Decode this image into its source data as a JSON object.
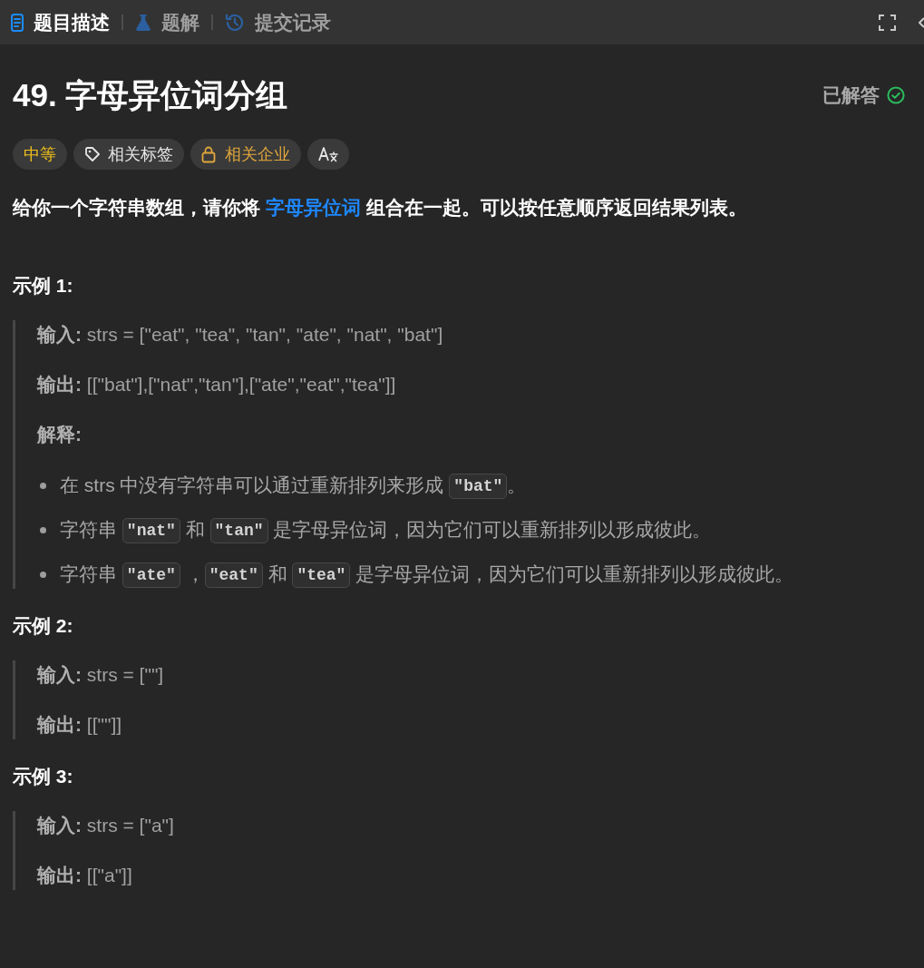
{
  "tabs": [
    {
      "label": "题目描述",
      "selected": true
    },
    {
      "label": "题解",
      "selected": false
    },
    {
      "label": "提交记录",
      "selected": false
    }
  ],
  "problem": {
    "title": "49. 字母异位词分组",
    "status": {
      "label": "已解答",
      "solved": true
    }
  },
  "tags": [
    {
      "kind": "difficulty",
      "label": "中等"
    },
    {
      "kind": "topics",
      "label": "相关标签"
    },
    {
      "kind": "companies",
      "label": "相关企业"
    },
    {
      "kind": "translate"
    }
  ],
  "description": [
    {
      "kind": "text",
      "text": "给你一个字符串数组，请你将 "
    },
    {
      "kind": "link",
      "text": "字母异位词"
    },
    {
      "kind": "text",
      "text": " 组合在一起。可以按任意顺序返回结果列表。"
    }
  ],
  "examples": [
    {
      "title": "示例 1:",
      "lines": [
        "**输入:** strs = [\"eat\", \"tea\", \"tan\", \"ate\", \"nat\", \"bat\"]",
        "**输出:** [[\"bat\"],[\"nat\",\"tan\"],[\"ate\",\"eat\",\"tea\"]]"
      ],
      "explanation": {
        "label": "解释:",
        "items": [
          {
            "parts": [
              {
                "kind": "text",
                "text": "在 strs 中没有字符串可以通过重新排列来形成 "
              },
              {
                "kind": "code",
                "text": "\"bat\""
              },
              {
                "kind": "text",
                "text": "。"
              }
            ]
          },
          {
            "parts": [
              {
                "kind": "text",
                "text": "字符串 "
              },
              {
                "kind": "code",
                "text": "\"nat\""
              },
              {
                "kind": "text",
                "text": " 和 "
              },
              {
                "kind": "code",
                "text": "\"tan\""
              },
              {
                "kind": "text",
                "text": " 是字母异位词，因为它们可以重新排列以形成彼此。"
              }
            ]
          },
          {
            "parts": [
              {
                "kind": "text",
                "text": "字符串 "
              },
              {
                "kind": "code",
                "text": "\"ate\""
              },
              {
                "kind": "text",
                "text": " ，"
              },
              {
                "kind": "code",
                "text": "\"eat\""
              },
              {
                "kind": "text",
                "text": " 和 "
              },
              {
                "kind": "code",
                "text": "\"tea\""
              },
              {
                "kind": "text",
                "text": " 是字母异位词，因为它们可以重新排列以形成彼此。"
              }
            ]
          }
        ]
      }
    },
    {
      "title": "示例 2:",
      "lines": [
        "**输入:** strs = [\"\"]",
        "**输出:** [[\"\"]]"
      ]
    },
    {
      "title": "示例 3:",
      "lines": [
        "**输入:** strs = [\"a\"]",
        "**输出:** [[\"a\"]]"
      ]
    }
  ]
}
